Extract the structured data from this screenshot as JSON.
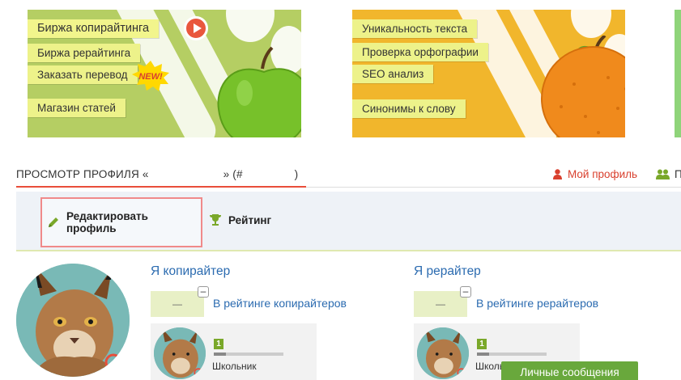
{
  "banners": {
    "copywriting": {
      "items": [
        {
          "label": "Биржа копирайтинга"
        },
        {
          "label": "Биржа рерайтинга"
        },
        {
          "label": "Заказать перевод"
        },
        {
          "label": "Магазин статей"
        }
      ],
      "new_badge": "NEW!",
      "color": "#b5ce63"
    },
    "tools": {
      "items": [
        {
          "label": "Уникальность текста"
        },
        {
          "label": "Проверка орфографии"
        },
        {
          "label": "SEO анализ"
        },
        {
          "label": "Синонимы к слову"
        }
      ],
      "color": "#f1b62c"
    }
  },
  "profile": {
    "header_prefix": "ПРОСМОТР ПРОФИЛЯ «",
    "header_suffix": "» (#",
    "header_end": ")",
    "my_profile": "Мой профиль",
    "people_link": "П",
    "accent": "#e94e3a"
  },
  "toolbar": {
    "edit_label": "Редактировать профиль",
    "rating_label": "Рейтинг"
  },
  "copywriter": {
    "title": "Я копирайтер",
    "rank_value": "—",
    "collapse_symbol": "–",
    "rating_link": "В рейтинге копирайтеров",
    "level": "1",
    "level_name": "Школьник",
    "level_progress": 0.18
  },
  "rewriter": {
    "title": "Я рерайтер",
    "rank_value": "—",
    "collapse_symbol": "–",
    "rating_link": "В рейтинге рерайтеров",
    "level": "1",
    "level_name": "Школьник",
    "level_progress": 0.18
  },
  "messages_button": "Личные сообщения"
}
